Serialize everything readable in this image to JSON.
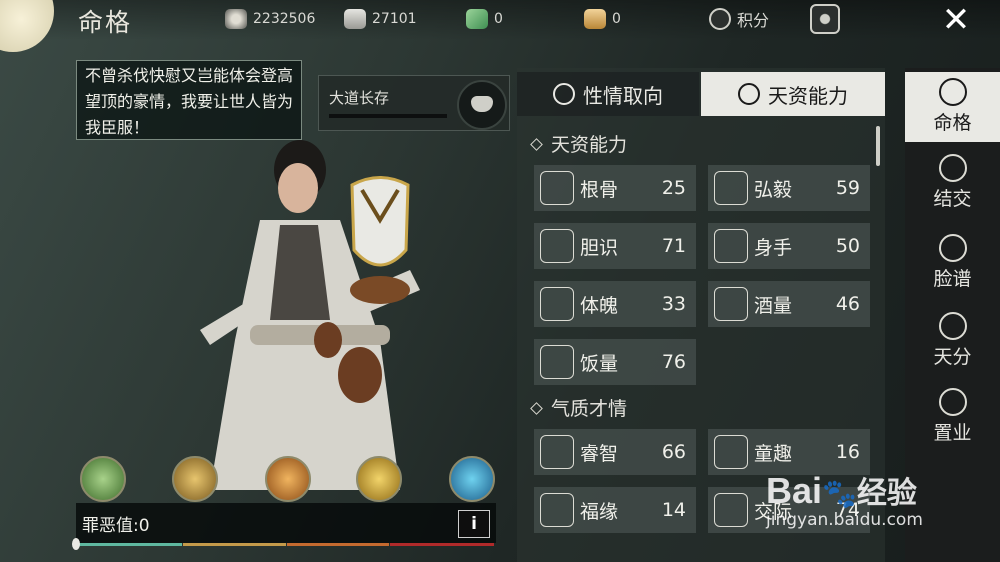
{
  "header": {
    "title": "命格",
    "resources": [
      {
        "icon": "coin-reel-icon",
        "value": "2232506"
      },
      {
        "icon": "silver-ingot-icon",
        "value": "27101"
      },
      {
        "icon": "green-ticket-icon",
        "value": "0"
      },
      {
        "icon": "gold-ingot-icon",
        "value": "0"
      }
    ],
    "points_label": "积分"
  },
  "speech": "不曾杀伐快慰又岂能体会登高望顶的豪情，我要让世人皆为我臣服！",
  "dao": {
    "label": "大道长存"
  },
  "skills": [
    "herb-skill-icon",
    "armor-skill-icon",
    "scroll-skill-icon",
    "eye-skill-icon",
    "sprint-skill-icon"
  ],
  "sin": {
    "label": "罪恶值:",
    "value": "0",
    "info_label": "i",
    "colors": [
      "#5fb8a0",
      "#c49a4a",
      "#c46a2f",
      "#b02a2a"
    ]
  },
  "tabs": [
    {
      "label": "性情取向",
      "active": false
    },
    {
      "label": "天资能力",
      "active": true
    }
  ],
  "sections": [
    {
      "title": "天资能力",
      "items": [
        {
          "name": "根骨",
          "value": "25",
          "icon": "bone-icon"
        },
        {
          "name": "弘毅",
          "value": "59",
          "icon": "bearded-man-icon"
        },
        {
          "name": "胆识",
          "value": "71",
          "icon": "demon-mask-icon"
        },
        {
          "name": "身手",
          "value": "50",
          "icon": "crossed-swords-icon"
        },
        {
          "name": "体魄",
          "value": "33",
          "icon": "robe-icon"
        },
        {
          "name": "酒量",
          "value": "46",
          "icon": "wine-jar-icon"
        },
        {
          "name": "饭量",
          "value": "76",
          "icon": "steamed-bun-icon"
        }
      ]
    },
    {
      "title": "气质才情",
      "items": [
        {
          "name": "睿智",
          "value": "66",
          "icon": "scholar-icon"
        },
        {
          "name": "童趣",
          "value": "16",
          "icon": "child-icon"
        },
        {
          "name": "福缘",
          "value": "14",
          "icon": "crescent-icon"
        },
        {
          "name": "交际",
          "value": "74",
          "icon": "handshake-icon"
        }
      ]
    }
  ],
  "sidebar": [
    {
      "label": "命格",
      "icon": "destiny-icon",
      "active": true
    },
    {
      "label": "结交",
      "icon": "friendship-icon",
      "active": false
    },
    {
      "label": "脸谱",
      "icon": "opera-mask-icon",
      "active": false
    },
    {
      "label": "天分",
      "icon": "talent-icon",
      "active": false
    },
    {
      "label": "置业",
      "icon": "property-icon",
      "active": false
    }
  ],
  "watermark": {
    "brand": "Bai",
    "brand2": "经验",
    "url": "jingyan.baidu.com"
  },
  "colors": {
    "accent_active_tab": "#e9e9e4",
    "panel_bg": "#2c3432",
    "card_bg": "#424b49"
  }
}
